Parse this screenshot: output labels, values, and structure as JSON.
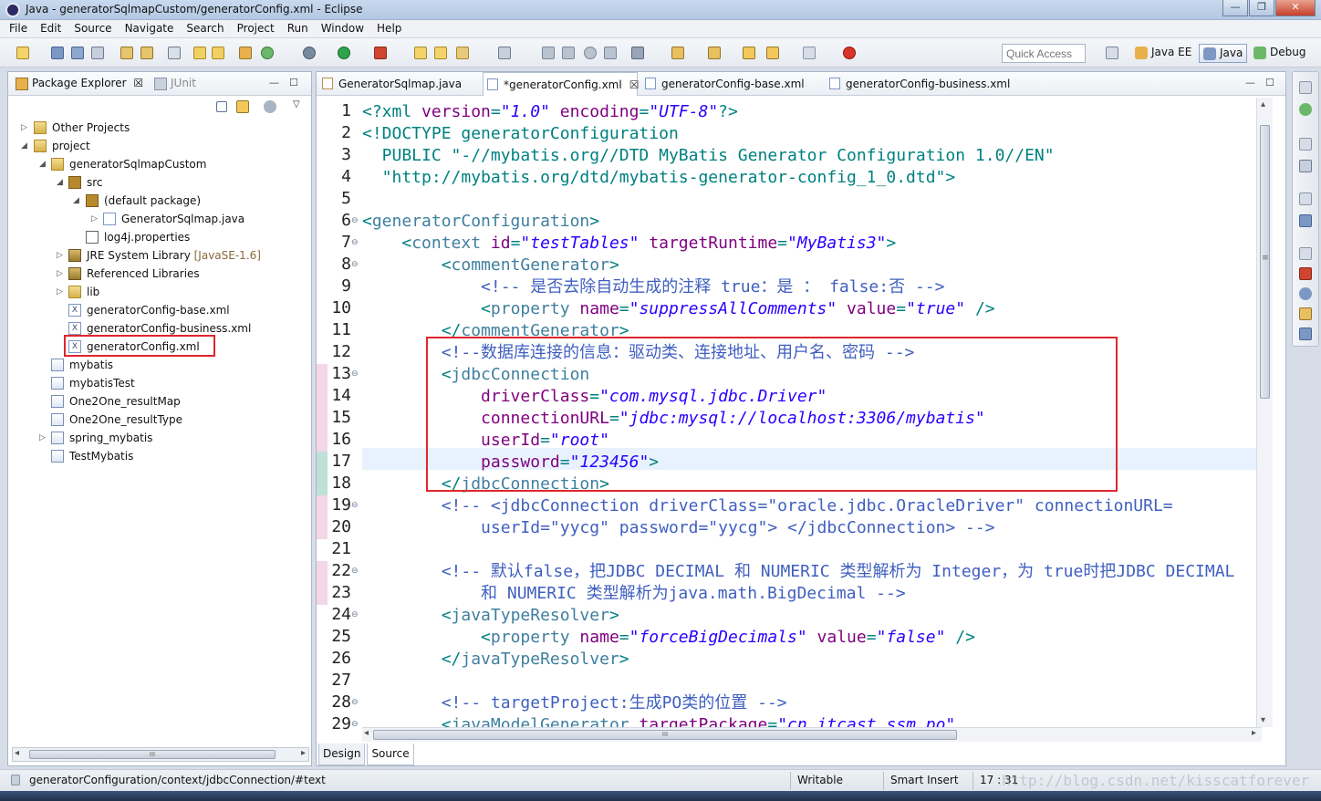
{
  "window": {
    "title": "Java - generatorSqlmapCustom/generatorConfig.xml - Eclipse",
    "min": "—",
    "max": "❐",
    "close": "✕"
  },
  "menu": [
    "File",
    "Edit",
    "Source",
    "Navigate",
    "Search",
    "Project",
    "Run",
    "Window",
    "Help"
  ],
  "toolbar": {
    "quick_access_placeholder": "Quick Access",
    "perspectives": [
      {
        "label": "Java EE",
        "active": false
      },
      {
        "label": "Java",
        "active": true
      },
      {
        "label": "Debug",
        "active": false
      }
    ]
  },
  "package_explorer": {
    "tab_label": "Package Explorer",
    "tab_close": "☒",
    "junit_label": "JUnit",
    "minimize": "—",
    "maximize": "☐",
    "tree": [
      {
        "label": "Other Projects",
        "twisty": "▷"
      },
      {
        "label": "project",
        "twisty": "◢"
      },
      {
        "label": "generatorSqlmapCustom",
        "twisty": "◢"
      },
      {
        "label": "src",
        "twisty": "◢"
      },
      {
        "label": "(default package)",
        "twisty": "◢"
      },
      {
        "label": "GeneratorSqlmap.java",
        "twisty": "▷"
      },
      {
        "label": "log4j.properties",
        "twisty": ""
      },
      {
        "label": "JRE System Library",
        "extra": "[JavaSE-1.6]",
        "twisty": "▷"
      },
      {
        "label": "Referenced Libraries",
        "twisty": "▷"
      },
      {
        "label": "lib",
        "twisty": "▷"
      },
      {
        "label": "generatorConfig-base.xml",
        "twisty": ""
      },
      {
        "label": "generatorConfig-business.xml",
        "twisty": ""
      },
      {
        "label": "generatorConfig.xml",
        "twisty": ""
      },
      {
        "label": "mybatis",
        "twisty": ""
      },
      {
        "label": "mybatisTest",
        "twisty": ""
      },
      {
        "label": "One2One_resultMap",
        "twisty": ""
      },
      {
        "label": "One2One_resultType",
        "twisty": ""
      },
      {
        "label": "spring_mybatis",
        "twisty": "▷"
      },
      {
        "label": "TestMybatis",
        "twisty": ""
      }
    ],
    "hscroll_grip": "III",
    "hscroll_left": "◂",
    "hscroll_right": "▸"
  },
  "editor": {
    "tabs": [
      {
        "label": "GeneratorSqlmap.java",
        "active": false,
        "close": ""
      },
      {
        "label": "*generatorConfig.xml",
        "active": true,
        "close": "☒"
      },
      {
        "label": "generatorConfig-base.xml",
        "active": false,
        "close": ""
      },
      {
        "label": "generatorConfig-business.xml",
        "active": false,
        "close": ""
      }
    ],
    "line_numbers": [
      "1",
      "2",
      "3",
      "4",
      "5",
      "6",
      "7",
      "8",
      "9",
      "10",
      "11",
      "12",
      "13",
      "14",
      "15",
      "16",
      "17",
      "18",
      "19",
      "20",
      "21",
      "22",
      "23",
      "24",
      "25",
      "26",
      "27",
      "28",
      "29"
    ],
    "code": [
      [
        "<?xml ",
        "version",
        "=",
        "\"1.0\"",
        " encoding",
        "=",
        "\"UTF-8\"",
        "?>"
      ],
      [
        "<!DOCTYPE generatorConfiguration"
      ],
      [
        "  PUBLIC \"-//mybatis.org//DTD MyBatis Generator Configuration 1.0//EN\""
      ],
      [
        "  \"http://mybatis.org/dtd/mybatis-generator-config_1_0.dtd\">"
      ],
      [
        ""
      ],
      [
        "<",
        "generatorConfiguration",
        ">"
      ],
      [
        "    <",
        "context",
        " id",
        "=",
        "\"testTables\"",
        " targetRuntime",
        "=",
        "\"MyBatis3\"",
        ">"
      ],
      [
        "        <",
        "commentGenerator",
        ">"
      ],
      [
        "            <!-- 是否去除自动生成的注释 true：是 ： false:否 -->"
      ],
      [
        "            <",
        "property",
        " name",
        "=",
        "\"suppressAllComments\"",
        " value",
        "=",
        "\"true\"",
        " />"
      ],
      [
        "        </",
        "commentGenerator",
        ">"
      ],
      [
        "        <!--数据库连接的信息：驱动类、连接地址、用户名、密码 -->"
      ],
      [
        "        <",
        "jdbcConnection"
      ],
      [
        "            driverClass",
        "=",
        "\"com.mysql.jdbc.Driver\""
      ],
      [
        "            connectionURL",
        "=",
        "\"jdbc:mysql://localhost:3306/mybatis\""
      ],
      [
        "            userId",
        "=",
        "\"root\""
      ],
      [
        "            password",
        "=",
        "\"123456\"",
        ">"
      ],
      [
        "        </",
        "jdbcConnection",
        ">"
      ],
      [
        "        <!-- <jdbcConnection driverClass=\"oracle.jdbc.OracleDriver\" connectionURL="
      ],
      [
        "            userId=\"yycg\" password=\"yycg\"> </jdbcConnection> -->"
      ],
      [
        ""
      ],
      [
        "        <!-- 默认false，把JDBC DECIMAL 和 NUMERIC 类型解析为 Integer，为 true时把JDBC DECIMAL"
      ],
      [
        "            和 NUMERIC 类型解析为java.math.BigDecimal -->"
      ],
      [
        "        <",
        "javaTypeResolver",
        ">"
      ],
      [
        "            <",
        "property",
        " name",
        "=",
        "\"forceBigDecimals\"",
        " value",
        "=",
        "\"false\"",
        " />"
      ],
      [
        "        </",
        "javaTypeResolver",
        ">"
      ],
      [
        ""
      ],
      [
        "        <!-- targetProject:生成PO类的位置 -->"
      ],
      [
        "        <",
        "javaModelGenerator",
        " targetPackage",
        "=",
        "\"cn.itcast.ssm.po\""
      ]
    ],
    "bottom_tabs": [
      "Design",
      "Source"
    ],
    "hscroll_grip": "III",
    "scroll_left": "◂",
    "scroll_right": "▸",
    "scroll_up": "▴",
    "scroll_down": "▾",
    "vscroll_grip": "≡",
    "minimize": "—",
    "maximize": "☐"
  },
  "status": {
    "path": "generatorConfiguration/context/jdbcConnection/#text",
    "writable": "Writable",
    "insert_mode": "Smart Insert",
    "position": "17 : 31"
  },
  "watermark": "http://blog.csdn.net/kisscatforever",
  "colors": {
    "highlight_box": "#e0262d",
    "tag": "#3f7f9f",
    "attr": "#7f007f",
    "value": "#2a00ff",
    "comment": "#3f5fbf"
  }
}
